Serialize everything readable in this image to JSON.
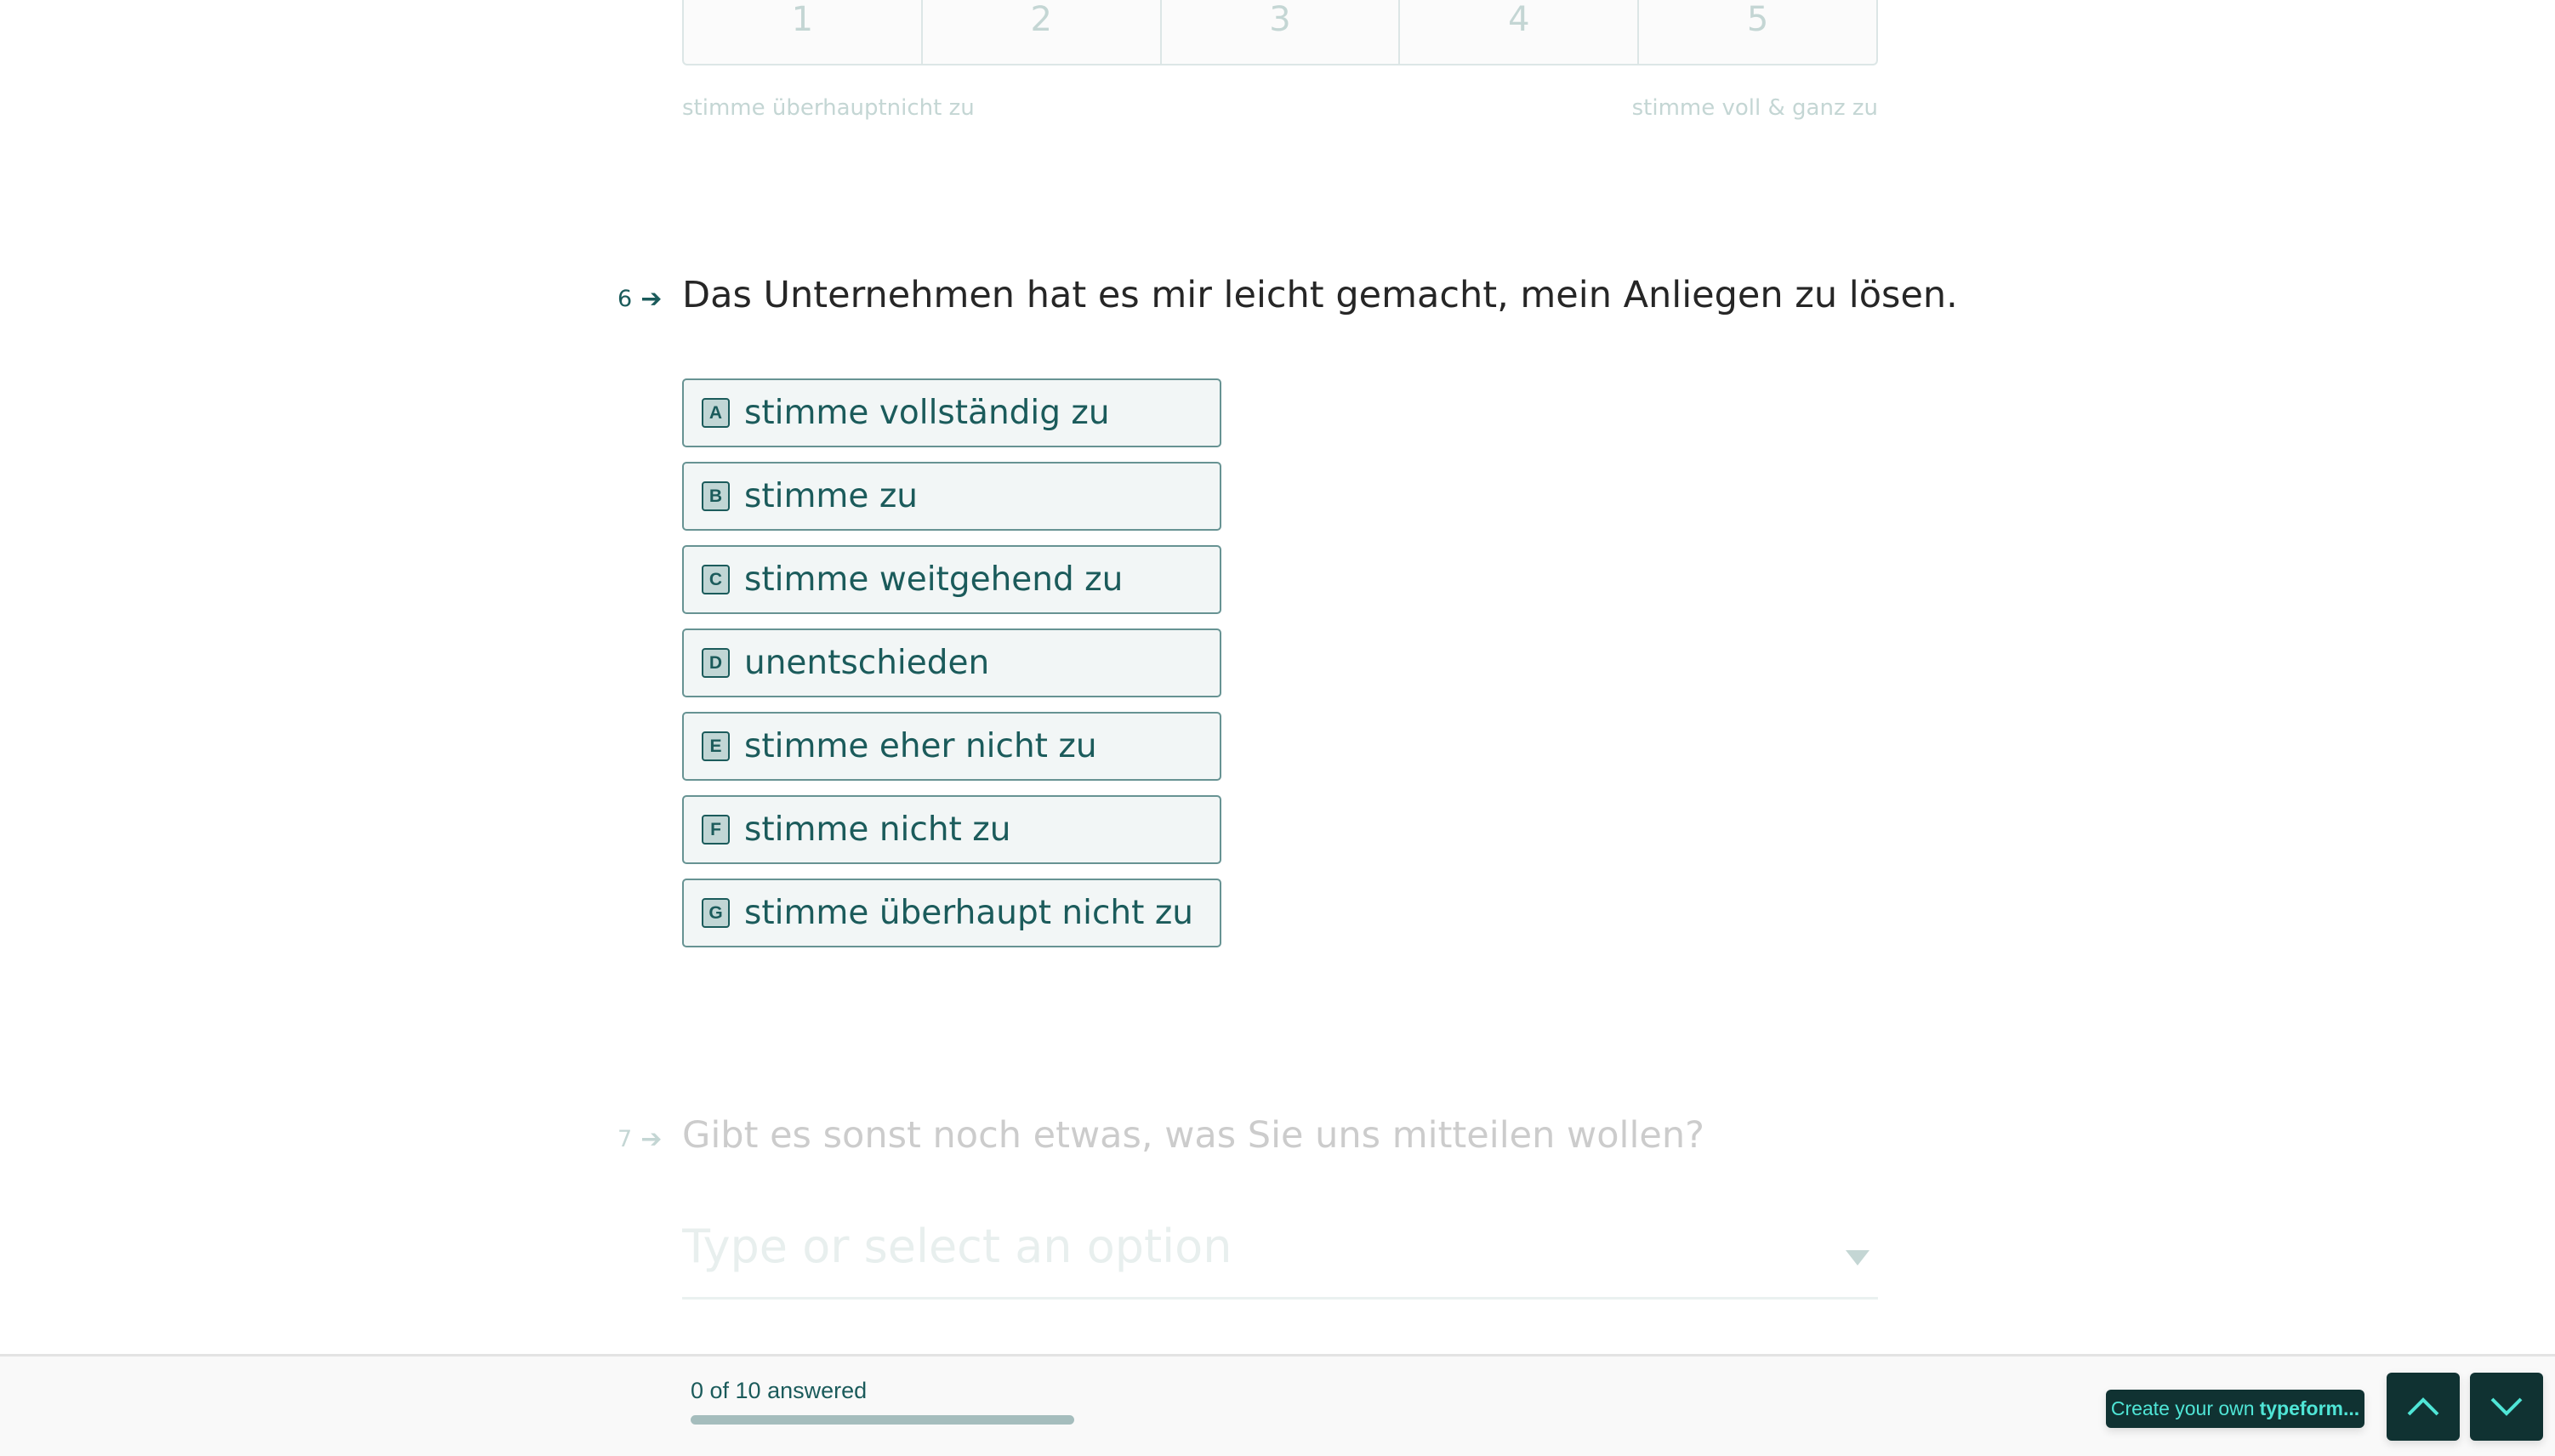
{
  "scale_question": {
    "values": [
      "1",
      "2",
      "3",
      "4",
      "5"
    ],
    "label_low": "stimme überhauptnicht zu",
    "label_high": "stimme voll & ganz zu"
  },
  "question6": {
    "number": "6",
    "arrow_icon": "arrow-right-icon",
    "title": "Das Unternehmen hat es mir leicht gemacht, mein Anliegen zu lösen.",
    "options": [
      {
        "key": "A",
        "label": "stimme vollständig zu"
      },
      {
        "key": "B",
        "label": "stimme zu"
      },
      {
        "key": "C",
        "label": "stimme weitgehend zu"
      },
      {
        "key": "D",
        "label": "unentschieden"
      },
      {
        "key": "E",
        "label": "stimme eher nicht zu"
      },
      {
        "key": "F",
        "label": "stimme nicht zu"
      },
      {
        "key": "G",
        "label": "stimme überhaupt nicht zu"
      }
    ]
  },
  "question7": {
    "number": "7",
    "arrow_icon": "arrow-right-icon",
    "title": "Gibt es sonst noch etwas, was Sie uns mitteilen wollen?",
    "dropdown": {
      "value": "",
      "placeholder": "Type or select an option",
      "icon": "caret-down-icon"
    }
  },
  "footer": {
    "progress_text": "0 of 10 answered",
    "answered": 0,
    "total": 10,
    "progress_fraction": 0,
    "brand_prefix": "Create your own",
    "brand_name": "typeform...",
    "up_icon": "chevron-up-icon",
    "down_icon": "chevron-down-icon"
  },
  "colors": {
    "primary": "#1b5b5b",
    "answer_bg": "#f2f6f6",
    "answer_border": "#679393",
    "brand_bg": "#103232",
    "brand_accent": "#4fe5d6"
  }
}
